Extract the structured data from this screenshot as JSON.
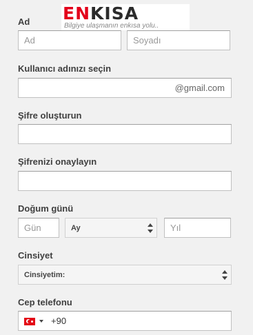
{
  "logo": {
    "brand_part1": "EN",
    "brand_part2": "KISA",
    "slogan": "Bilgiye ulaşmanın enkısa yolu.."
  },
  "name": {
    "label": "Ad",
    "first_placeholder": "Ad",
    "last_placeholder": "Soyadı"
  },
  "username": {
    "label": "Kullanıcı adınızı seçin",
    "suffix": "@gmail.com"
  },
  "password": {
    "label": "Şifre oluşturun"
  },
  "confirm": {
    "label": "Şifrenizi onaylayın"
  },
  "birthday": {
    "label": "Doğum günü",
    "day_placeholder": "Gün",
    "month_selected": "Ay",
    "year_placeholder": "Yıl"
  },
  "gender": {
    "label": "Cinsiyet",
    "selected": "Cinsiyetim:"
  },
  "phone": {
    "label": "Cep telefonu",
    "country_flag_icon": "turkey-flag-icon",
    "code": "+90"
  }
}
